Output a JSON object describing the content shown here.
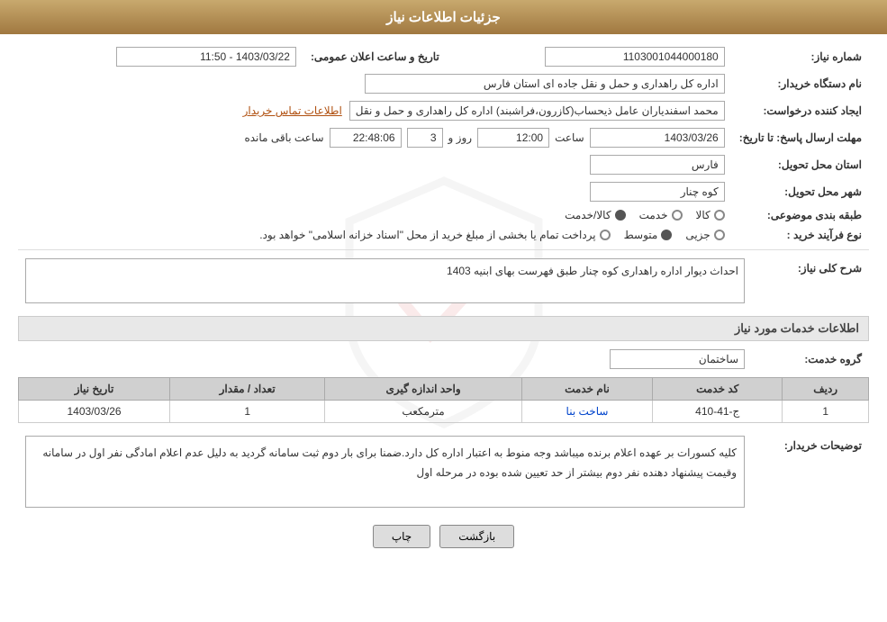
{
  "header": {
    "title": "جزئیات اطلاعات نیاز"
  },
  "fields": {
    "need_number_label": "شماره نیاز:",
    "need_number_value": "1103001044000180",
    "buyer_org_label": "نام دستگاه خریدار:",
    "buyer_org_value": "اداره کل راهداری و حمل و نقل جاده ای استان فارس",
    "creator_label": "ایجاد کننده درخواست:",
    "creator_value": "محمد اسفندیاران عامل ذیحساب(کازرون،فراشبند) اداره کل راهداری و حمل و نقل",
    "creator_link": "اطلاعات تماس خریدار",
    "deadline_label": "مهلت ارسال پاسخ: تا تاریخ:",
    "deadline_date": "1403/03/26",
    "deadline_time_label": "ساعت",
    "deadline_time": "12:00",
    "deadline_day_label": "روز و",
    "deadline_days": "3",
    "deadline_remaining_label": "ساعت باقی مانده",
    "deadline_remaining": "22:48:06",
    "province_label": "استان محل تحویل:",
    "province_value": "فارس",
    "city_label": "شهر محل تحویل:",
    "city_value": "کوه چنار",
    "announce_label": "تاریخ و ساعت اعلان عمومی:",
    "announce_value": "1403/03/22 - 11:50",
    "category_label": "طبقه بندی موضوعی:",
    "category_options": [
      {
        "label": "کالا",
        "selected": false
      },
      {
        "label": "خدمت",
        "selected": true
      },
      {
        "label": "کالا/خدمت",
        "selected": false
      }
    ],
    "process_label": "نوع فرآیند خرید :",
    "process_options": [
      {
        "label": "جزیی",
        "selected": false
      },
      {
        "label": "متوسط",
        "selected": true
      },
      {
        "label": "پرداخت تمام یا بخشی از مبلغ خرید از محل \"اسناد خزانه اسلامی\" خواهد بود.",
        "selected": false
      }
    ],
    "description_label": "شرح کلی نیاز:",
    "description_value": "احداث دیوار اداره راهداری کوه چنار طبق فهرست بهای ابنیه 1403",
    "services_section": "اطلاعات خدمات مورد نیاز",
    "service_group_label": "گروه خدمت:",
    "service_group_value": "ساختمان",
    "table": {
      "headers": [
        "ردیف",
        "کد خدمت",
        "نام خدمت",
        "واحد اندازه گیری",
        "تعداد / مقدار",
        "تاریخ نیاز"
      ],
      "rows": [
        {
          "row": "1",
          "code": "ج-41-410",
          "name": "ساخت بنا",
          "unit": "مترمکعب",
          "quantity": "1",
          "date": "1403/03/26"
        }
      ]
    },
    "notes_label": "توضیحات خریدار:",
    "notes_value": "کلیه کسورات بر عهده اعلام برنده میباشد وجه منوط به اعتبار اداره کل دارد.ضمنا برای بار دوم ثبت سامانه گردید به دلیل عدم اعلام امادگی نفر اول  در سامانه وقیمت پیشنهاد دهنده نفر دوم بیشتر از حد تعیین شده بوده در مرحله اول"
  },
  "buttons": {
    "print": "چاپ",
    "back": "بازگشت"
  }
}
